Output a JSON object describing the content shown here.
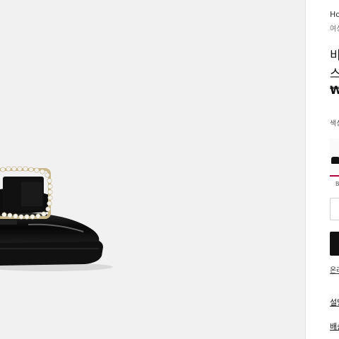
{
  "breadcrumb": {
    "home": "Ho",
    "category": "여성"
  },
  "product": {
    "title_line1": "비",
    "title_line2": "스",
    "price": "₩"
  },
  "options": {
    "color_label": "색상",
    "swatch_caption": "B"
  },
  "actions": {
    "add_to_cart": "",
    "secondary_link": "온라"
  },
  "accordions": {
    "description": "설명",
    "shipping": "배송"
  },
  "colors": {
    "gallery_bg": "#f1f1f1",
    "accent": "#b0003a",
    "button": "#111111"
  }
}
